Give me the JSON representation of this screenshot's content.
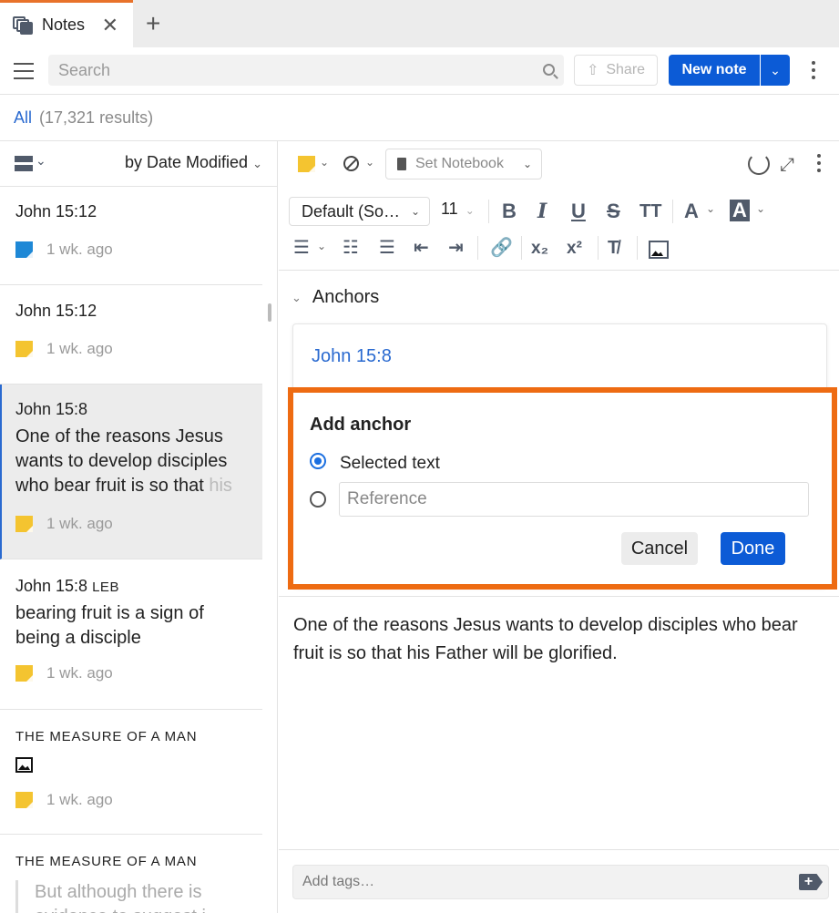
{
  "tab": {
    "label": "Notes",
    "close_symbol": "✕",
    "new_tab_symbol": "+"
  },
  "toolbar": {
    "search_placeholder": "Search",
    "share_label": "Share",
    "new_note_label": "New note"
  },
  "results": {
    "filter": "All",
    "count": "(17,321 results)"
  },
  "list": {
    "sort_label": "by Date Modified",
    "notes": [
      {
        "title": "John 15:12",
        "time": "1 wk. ago",
        "color": "#1e88d6"
      },
      {
        "title": "John 15:12",
        "time": "1 wk. ago",
        "color": "#f4c430"
      },
      {
        "title": "John 15:8",
        "body": "One of the reasons Jesus wants to develop disciples who bear fruit is so that ",
        "body_fade": "his",
        "time": "1 wk. ago",
        "color": "#f4c430"
      },
      {
        "title": "John 15:8",
        "title_suffix": "LEB",
        "body": "bearing fruit is a sign of being a disciple",
        "time": "1 wk. ago",
        "color": "#f4c430"
      },
      {
        "title": "THE MEASURE OF A MAN",
        "time": "1 wk. ago",
        "color": "#f4c430"
      },
      {
        "title": "THE MEASURE OF A MAN",
        "quote": "But although there is evidence to suggest i..."
      }
    ]
  },
  "editor": {
    "notebook_placeholder": "Set Notebook",
    "font_family": "Default (So…",
    "font_size": "11",
    "format_buttons": [
      "B",
      "I",
      "U",
      "S",
      "TT",
      "A",
      "A",
      "x₂",
      "x²"
    ],
    "anchors_heading": "Anchors",
    "anchor_ref": "John 15:8",
    "add_anchor": {
      "title": "Add anchor",
      "option_selected": "Selected text",
      "reference_placeholder": "Reference",
      "cancel_label": "Cancel",
      "done_label": "Done"
    },
    "note_text": "One of the reasons Jesus wants to develop disciples who bear fruit is so that his Father will be glorified.",
    "tags_placeholder": "Add tags…"
  },
  "colors": {
    "accent": "#0c5bd6",
    "highlight_border": "#ee6b12",
    "link": "#2a6ad0",
    "sticky_yellow": "#f4c430",
    "sticky_blue": "#1e88d6"
  }
}
